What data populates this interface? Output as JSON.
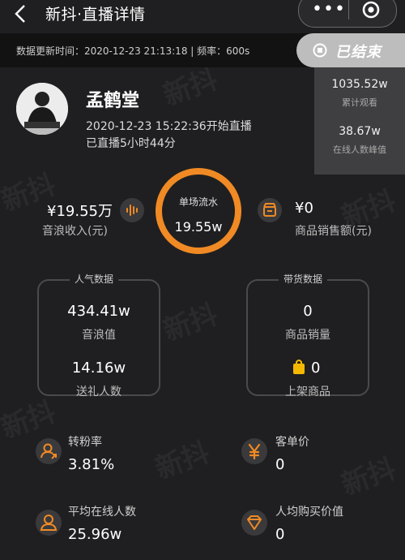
{
  "nav": {
    "title": "新抖·直播详情",
    "dots": "•••"
  },
  "update": {
    "text": "数据更新时间：2020-12-23 21:13:18  |  频率：600s",
    "ended": "已结束"
  },
  "popup": {
    "total_views": "1035.52w",
    "total_views_label": "累计观看",
    "peak_online": "38.67w",
    "peak_online_label": "在线人数峰值"
  },
  "profile": {
    "name": "孟鹤堂",
    "start": "2020-12-23 15:22:36开始直播",
    "duration": "已直播5小时44分"
  },
  "revenue": {
    "sound_value": "¥19.55万",
    "sound_label": "音浪收入(元)",
    "sales_value": "¥0",
    "sales_label": "商品销售额(元)"
  },
  "center": {
    "label": "单场流水",
    "value": "19.55w"
  },
  "popularity": {
    "title": "人气数据",
    "sound_waves": "434.41w",
    "sound_waves_label": "音浪值",
    "gift_givers": "14.16w",
    "gift_givers_label": "送礼人数"
  },
  "goods": {
    "title": "带货数据",
    "sales_volume": "0",
    "sales_volume_label": "商品销量",
    "listed": "0",
    "listed_label": "上架商品"
  },
  "metrics": {
    "conversion_label": "转粉率",
    "conversion": "3.81%",
    "unit_price_label": "客单价",
    "unit_price": "0",
    "avg_online_label": "平均在线人数",
    "avg_online": "25.96w",
    "per_capita_label": "人均购买价值",
    "per_capita": "0"
  },
  "watermark": "新抖",
  "colors": {
    "accent": "#f08a24",
    "background": "#1f1f21",
    "ended_bg": "#bdbdbd"
  }
}
